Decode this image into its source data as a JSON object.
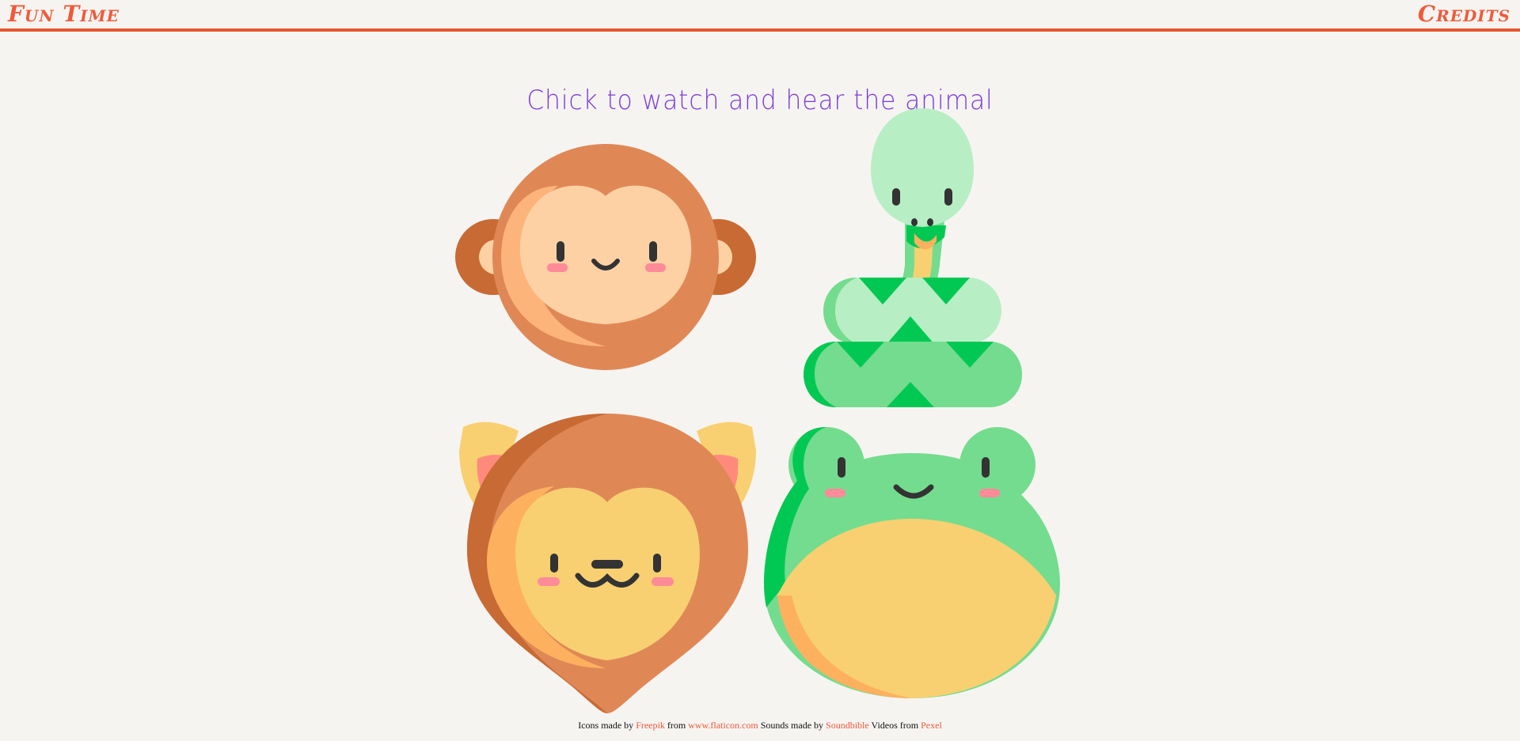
{
  "header": {
    "brand": "Fun Time",
    "credits_link": "Credits"
  },
  "main": {
    "heading": "Chick to watch and hear the animal"
  },
  "animals": [
    {
      "name": "monkey"
    },
    {
      "name": "snake"
    },
    {
      "name": "lion"
    },
    {
      "name": "frog"
    }
  ],
  "footer": {
    "icons_prefix": "Icons made by",
    "icons_author": "Freepik",
    "from_text": "from",
    "icons_site": "www.flaticon.com",
    "sounds_prefix": "Sounds made by",
    "sounds_author": "Soundbible",
    "videos_prefix": "Videos from",
    "videos_source": "Pexel"
  },
  "colors": {
    "accent": "#e8572c",
    "link": "#ef5a3a",
    "heading": "#7a3cdc",
    "background": "#f6f4f1"
  }
}
